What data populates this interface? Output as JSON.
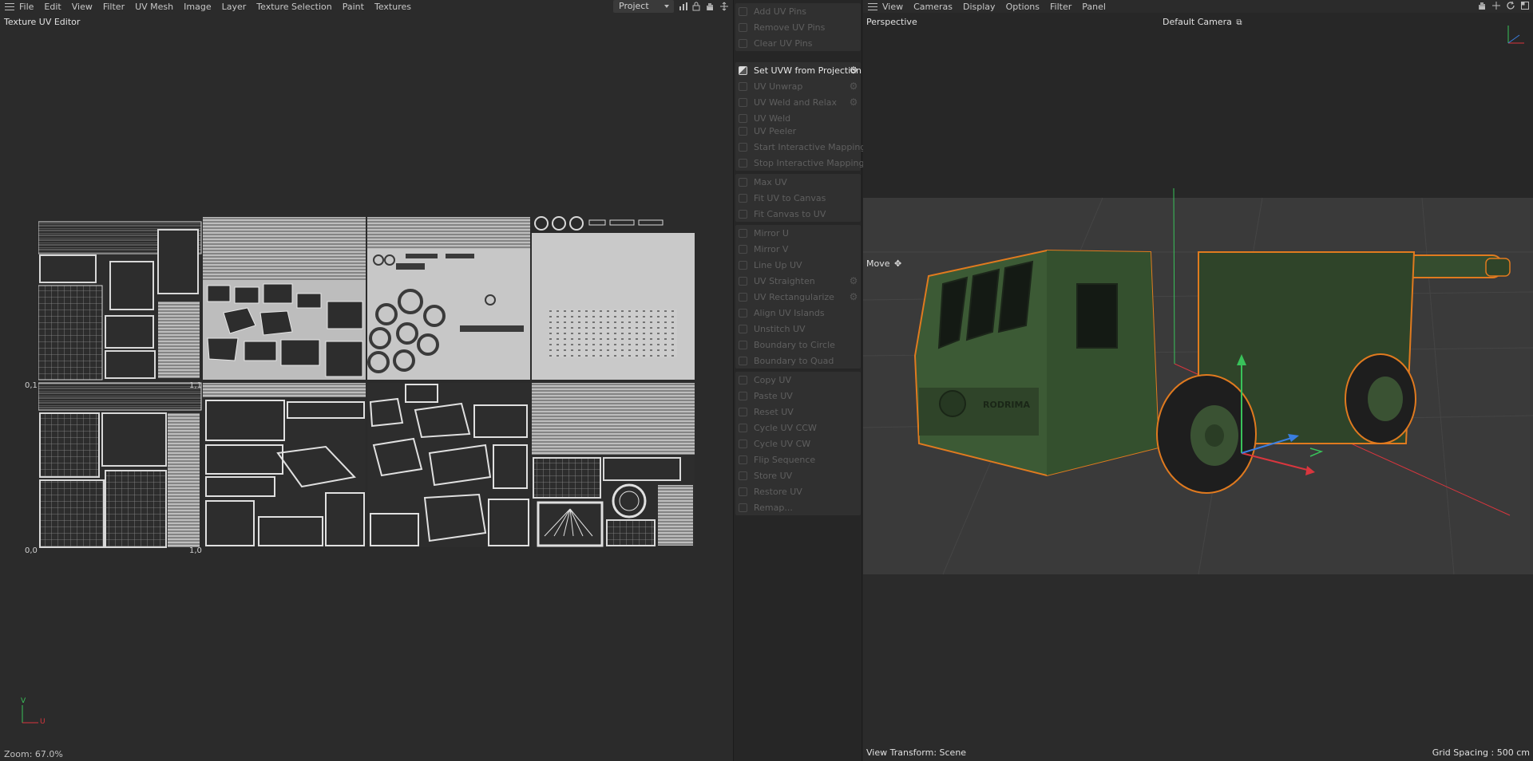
{
  "uv_editor": {
    "menu": [
      "File",
      "Edit",
      "View",
      "Filter",
      "UV Mesh",
      "Image",
      "Layer",
      "Texture Selection",
      "Paint",
      "Textures"
    ],
    "project_select": "Project",
    "panel_title": "Texture UV Editor",
    "coord_labels": {
      "top_left": "0,1",
      "top_right": "1,1",
      "bottom_left": "0,0",
      "bottom_right": "1,0"
    },
    "axis_v": "V",
    "axis_u": "U",
    "zoom": "Zoom: 67.0%",
    "toolbar_icons": [
      "chart-icon",
      "lock-icon",
      "hand-icon",
      "pin-icon"
    ]
  },
  "uv_commands": {
    "groups": [
      [
        "Add UV Pins",
        "Remove UV Pins",
        "Clear UV Pins"
      ],
      [
        "Set UVW from Projection",
        "UV Unwrap",
        "UV Weld and Relax",
        "UV Weld"
      ],
      [
        "UV Peeler",
        "Start Interactive Mapping",
        "Stop Interactive Mapping"
      ],
      [
        "Max UV",
        "Fit UV to Canvas",
        "Fit Canvas to UV"
      ],
      [
        "Mirror U",
        "Mirror V",
        "Line Up UV",
        "UV Straighten",
        "UV Rectangularize",
        "Align UV Islands",
        "Unstitch UV",
        "Boundary to Circle",
        "Boundary to Quad"
      ],
      [
        "Copy UV",
        "Paste UV",
        "Reset UV",
        "Cycle UV CCW",
        "Cycle UV CW",
        "Flip Sequence",
        "Store UV",
        "Restore UV",
        "Remap..."
      ]
    ],
    "active": "Set UVW from Projection",
    "with_settings": [
      "Set UVW from Projection",
      "UV Unwrap",
      "UV Weld and Relax",
      "UV Straighten",
      "UV Rectangularize"
    ]
  },
  "viewport": {
    "menu": [
      "View",
      "Cameras",
      "Display",
      "Options",
      "Filter",
      "Panel"
    ],
    "view_name": "Perspective",
    "camera": "Default Camera",
    "tool": "Move",
    "view_transform": "View Transform: Scene",
    "grid_spacing": "Grid Spacing : 500 cm",
    "decal_text": "RODRIMA",
    "toolbar_icons": [
      "hand-icon",
      "pin-icon",
      "rotate-icon",
      "maximize-icon"
    ]
  },
  "colors": {
    "selection_outline": "#e07a1f",
    "axis_x": "#d9363e",
    "axis_y": "#39c25a",
    "axis_z": "#3a7ee0",
    "vehicle_green": "#3c5a35"
  }
}
